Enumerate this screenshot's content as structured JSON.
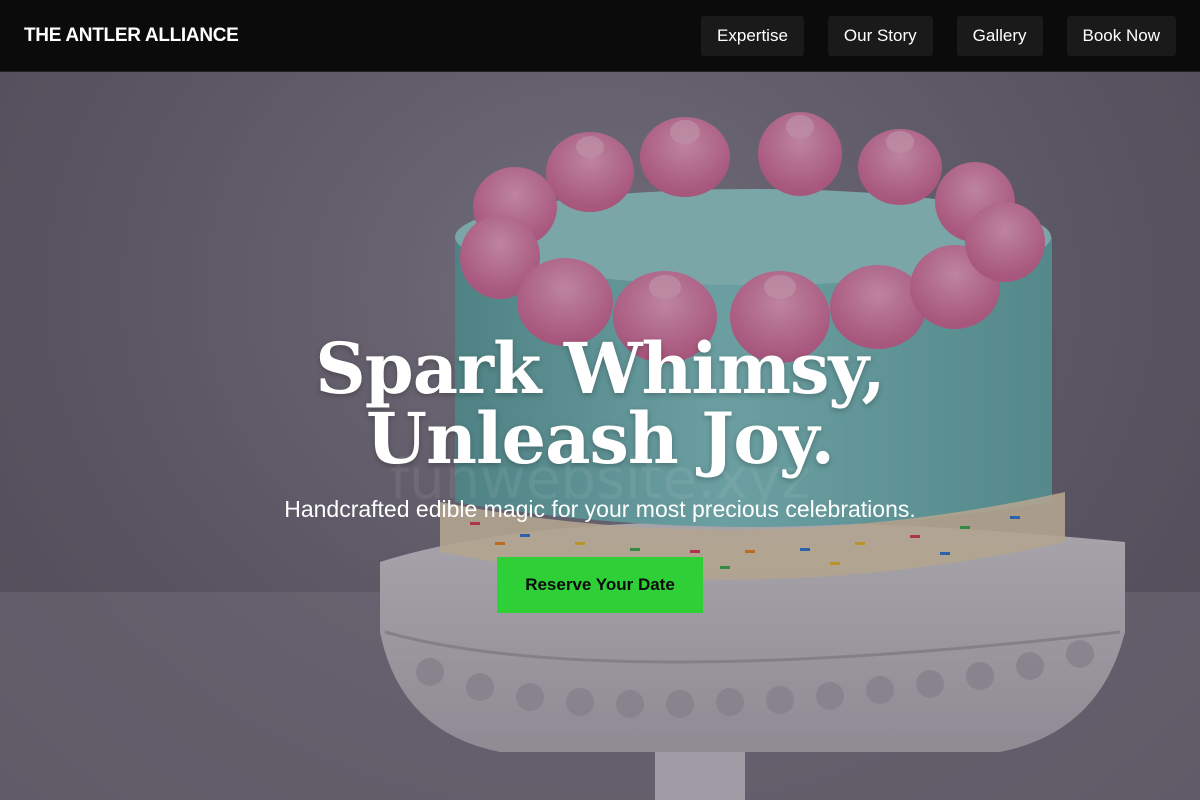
{
  "header": {
    "brand": "THE ANTLER ALLIANCE",
    "nav": [
      {
        "label": "Expertise"
      },
      {
        "label": "Our Story"
      },
      {
        "label": "Gallery"
      },
      {
        "label": "Book Now"
      }
    ]
  },
  "hero": {
    "headline_line1": "Spark Whimsy,",
    "headline_line2": "Unleash Joy.",
    "subheadline": "Handcrafted edible magic for your most precious celebrations.",
    "cta_label": "Reserve Your Date",
    "watermark": "funwebsite.xyz",
    "image_alt": "cake-photo"
  },
  "colors": {
    "header_bg": "#0b0b0b",
    "cta_bg": "#2fcf37",
    "frosting_pink": "#f08bb6",
    "cake_teal": "#7ec7c6",
    "stand_white": "#e8e6ea"
  }
}
